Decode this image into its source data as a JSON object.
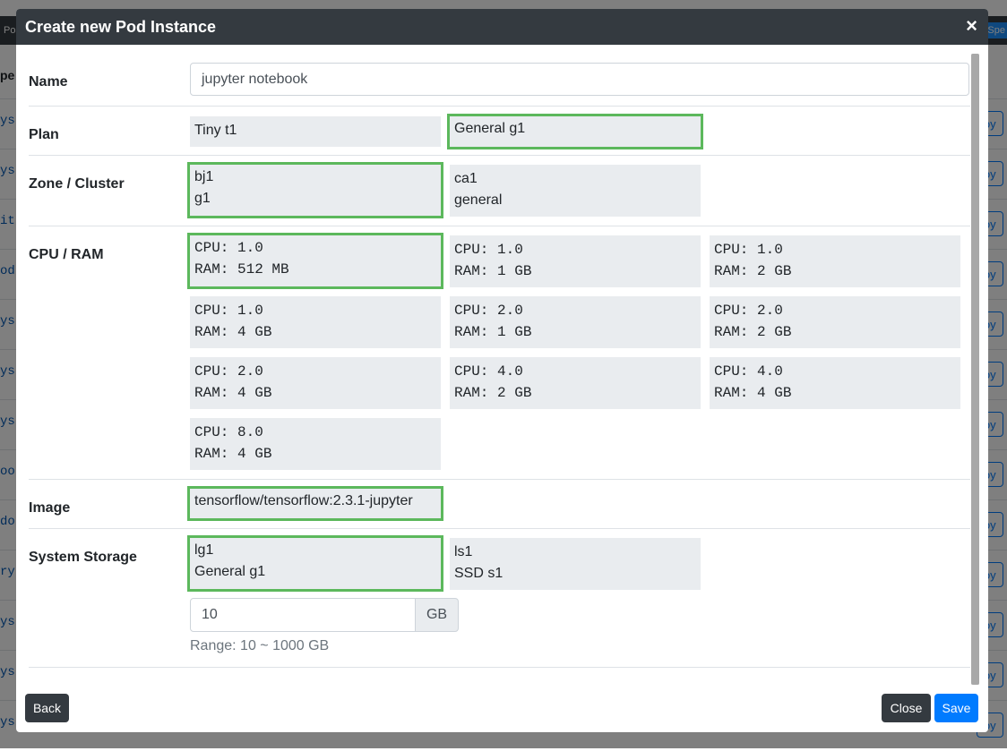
{
  "background": {
    "topbar_left": "Po",
    "topbar_right": "nSpe",
    "column_header": "pe",
    "rows": [
      {
        "text": "ys",
        "action": "loy"
      },
      {
        "text": "ys",
        "action": "loy"
      },
      {
        "text": "it",
        "action": "loy"
      },
      {
        "text": "od",
        "action": "loy"
      },
      {
        "text": "ys",
        "action": "loy"
      },
      {
        "text": "ys",
        "action": "loy"
      },
      {
        "text": "ys",
        "action": "loy"
      },
      {
        "text": "oo",
        "action": "loy"
      },
      {
        "text": "do",
        "action": "loy"
      },
      {
        "text": "ry",
        "action": "loy"
      },
      {
        "text": "ys",
        "action": "loy"
      },
      {
        "text": "ys",
        "action": "loy"
      },
      {
        "text": "ys",
        "action": "loy"
      }
    ]
  },
  "modal": {
    "title": "Create new Pod Instance",
    "close_symbol": "×",
    "name": {
      "label": "Name",
      "value": "jupyter notebook"
    },
    "plan": {
      "label": "Plan",
      "options": [
        {
          "line1": "Tiny t1",
          "selected": false
        },
        {
          "line1": "General g1",
          "selected": true
        }
      ]
    },
    "zone": {
      "label": "Zone / Cluster",
      "options": [
        {
          "line1": "bj1",
          "line2": "g1",
          "selected": true
        },
        {
          "line1": "ca1",
          "line2": "general",
          "selected": false
        }
      ]
    },
    "cpu_ram": {
      "label": "CPU / RAM",
      "options": [
        {
          "line1": "CPU: 1.0",
          "line2": "RAM: 512 MB",
          "selected": true
        },
        {
          "line1": "CPU: 1.0",
          "line2": "RAM: 1 GB",
          "selected": false
        },
        {
          "line1": "CPU: 1.0",
          "line2": "RAM: 2 GB",
          "selected": false
        },
        {
          "line1": "CPU: 1.0",
          "line2": "RAM: 4 GB",
          "selected": false
        },
        {
          "line1": "CPU: 2.0",
          "line2": "RAM: 1 GB",
          "selected": false
        },
        {
          "line1": "CPU: 2.0",
          "line2": "RAM: 2 GB",
          "selected": false
        },
        {
          "line1": "CPU: 2.0",
          "line2": "RAM: 4 GB",
          "selected": false
        },
        {
          "line1": "CPU: 4.0",
          "line2": "RAM: 2 GB",
          "selected": false
        },
        {
          "line1": "CPU: 4.0",
          "line2": "RAM: 4 GB",
          "selected": false
        },
        {
          "line1": "CPU: 8.0",
          "line2": "RAM: 4 GB",
          "selected": false
        }
      ]
    },
    "image": {
      "label": "Image",
      "options": [
        {
          "line1": "tensorflow/tensorflow:2.3.1-jupyter",
          "selected": true
        }
      ]
    },
    "storage": {
      "label": "System Storage",
      "options": [
        {
          "line1": "lg1",
          "line2": "General g1",
          "selected": true
        },
        {
          "line1": "ls1",
          "line2": "SSD s1",
          "selected": false
        }
      ],
      "size_value": "10",
      "size_unit": "GB",
      "range_hint": "Range: 10 ~ 1000 GB"
    },
    "buttons": {
      "back": "Back",
      "close": "Close",
      "save": "Save"
    }
  },
  "colors": {
    "header_bg": "#343a40",
    "selected_border": "#5cb85c",
    "option_bg": "#e9ecef",
    "primary": "#007bff"
  }
}
